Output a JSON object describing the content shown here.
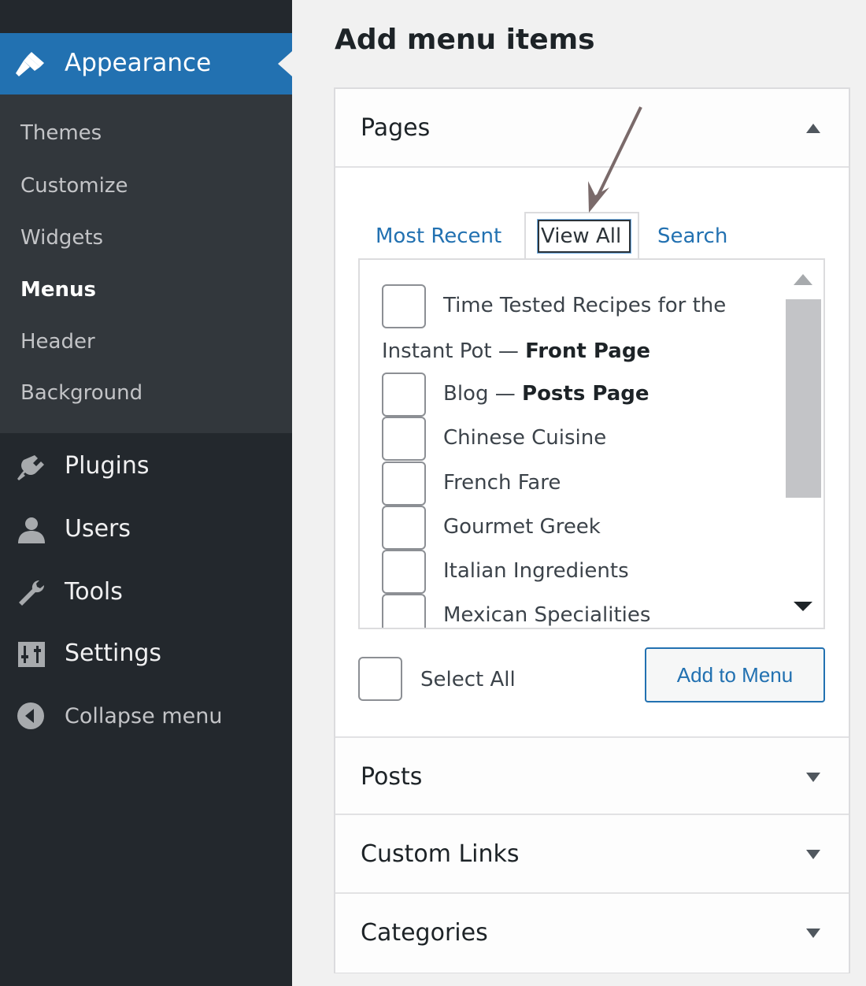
{
  "sidebar": {
    "appearance": {
      "label": "Appearance",
      "icon": "paintbrush-icon"
    },
    "submenu": [
      {
        "label": "Themes"
      },
      {
        "label": "Customize"
      },
      {
        "label": "Widgets"
      },
      {
        "label": "Menus",
        "current": true
      },
      {
        "label": "Header"
      },
      {
        "label": "Background"
      }
    ],
    "items": [
      {
        "label": "Plugins",
        "icon": "plugin-icon"
      },
      {
        "label": "Users",
        "icon": "user-icon"
      },
      {
        "label": "Tools",
        "icon": "wrench-icon"
      },
      {
        "label": "Settings",
        "icon": "settings-sliders-icon"
      },
      {
        "label": "Collapse menu",
        "icon": "collapse-arrow-icon"
      }
    ]
  },
  "main": {
    "heading": "Add menu items",
    "pages_section": {
      "title": "Pages",
      "tabs": [
        {
          "label": "Most Recent"
        },
        {
          "label": "View All",
          "active": true
        },
        {
          "label": "Search"
        }
      ],
      "items": [
        {
          "line1": "Time Tested Recipes for the",
          "line2_plain": "Instant Pot — ",
          "line2_bold": "Front Page"
        },
        {
          "plain": "Blog — ",
          "bold": "Posts Page"
        },
        {
          "plain": "Chinese Cuisine"
        },
        {
          "plain": "French Fare"
        },
        {
          "plain": "Gourmet Greek"
        },
        {
          "plain": "Italian Ingredients"
        },
        {
          "plain": "Mexican Specialities"
        }
      ],
      "select_all_label": "Select All",
      "add_button_label": "Add to Menu"
    },
    "collapsed_sections": [
      {
        "title": "Posts"
      },
      {
        "title": "Custom Links"
      },
      {
        "title": "Categories"
      }
    ]
  },
  "colors": {
    "sidebar_bg": "#23282d",
    "submenu_bg": "#32373c",
    "accent": "#2271b1",
    "annotation_arrow": "#7a6a6a"
  }
}
